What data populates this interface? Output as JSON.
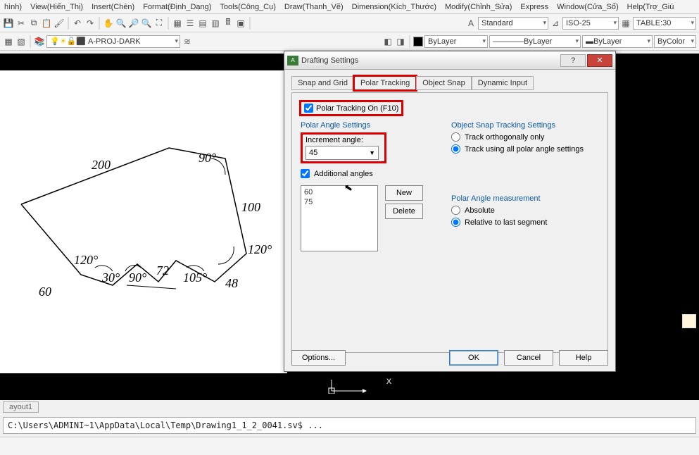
{
  "menu": {
    "items": [
      "hình)",
      "View(Hiển_Thị)",
      "Insert(Chèn)",
      "Format(Định_Dạng)",
      "Tools(Công_Cụ)",
      "Draw(Thanh_Vẽ)",
      "Dimension(Kích_Thước)",
      "Modify(Chỉnh_Sửa)",
      "Express",
      "Window(Cửa_Sổ)",
      "Help(Trợ_Giú"
    ]
  },
  "toolbars": {
    "style1": "Standard",
    "style2": "ISO-25",
    "style3": "TABLE:30",
    "layer": "A-PROJ-DARK",
    "prop1": "ByLayer",
    "prop2": "ByLayer",
    "prop3": "ByLayer",
    "prop4": "ByColor"
  },
  "layout_tab": "ayout1",
  "cmdline": "C:\\Users\\ADMINI~1\\AppData\\Local\\Temp\\Drawing1_1_2_0041.sv$ ...",
  "drawing": {
    "labels": [
      "200",
      "90°",
      "100",
      "120°",
      "120°",
      "30°",
      "90°",
      "72",
      "105°",
      "48",
      "60"
    ]
  },
  "dialog": {
    "title": "Drafting Settings",
    "tabs": [
      "Snap and Grid",
      "Polar Tracking",
      "Object Snap",
      "Dynamic Input"
    ],
    "polar_on": "Polar Tracking On (F10)",
    "polar_angle_heading": "Polar Angle Settings",
    "increment_label": "Increment angle:",
    "increment_value": "45",
    "additional_label": "Additional angles",
    "angles": [
      "60",
      "75"
    ],
    "new_btn": "New",
    "delete_btn": "Delete",
    "ost_heading": "Object Snap Tracking Settings",
    "ost_ortho": "Track orthogonally only",
    "ost_all": "Track using all polar angle settings",
    "pam_heading": "Polar Angle measurement",
    "pam_abs": "Absolute",
    "pam_rel": "Relative to last segment",
    "options_btn": "Options...",
    "ok": "OK",
    "cancel": "Cancel",
    "help": "Help"
  },
  "ucs_text": "X"
}
